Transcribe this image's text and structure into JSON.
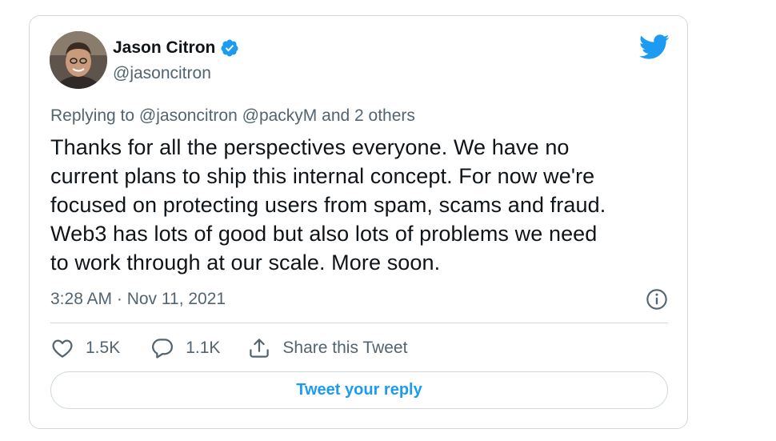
{
  "author": {
    "name": "Jason Citron",
    "handle": "@jasoncitron",
    "verified": true,
    "avatar_icon": "profile-photo"
  },
  "reply_context": {
    "prefix": "Replying to",
    "mentions": [
      "@jasoncitron",
      "@packyM"
    ],
    "others": "and 2 others"
  },
  "tweet": {
    "lines": [
      "Thanks for all the perspectives everyone. We have no",
      "current plans to ship this internal concept. For now we're",
      "focused on protecting users from spam, scams and fraud.",
      "Web3 has lots of good but also lots of problems we need",
      "to work through at our scale. More soon."
    ],
    "timestamp": "3:28 AM · Nov 11, 2021"
  },
  "actions": {
    "likes": "1.5K",
    "replies": "1.1K",
    "share_label": "Share this Tweet"
  },
  "reply_button_label": "Tweet your reply",
  "icons": {
    "brand": "twitter-bird-icon",
    "verified": "verified-badge-icon",
    "info": "info-icon",
    "like": "heart-icon",
    "reply": "comment-icon",
    "share": "share-icon"
  },
  "colors": {
    "brand_blue": "#1d9bf0",
    "text_primary": "#0f1419",
    "text_secondary": "#536471",
    "border": "#cfd9de"
  }
}
